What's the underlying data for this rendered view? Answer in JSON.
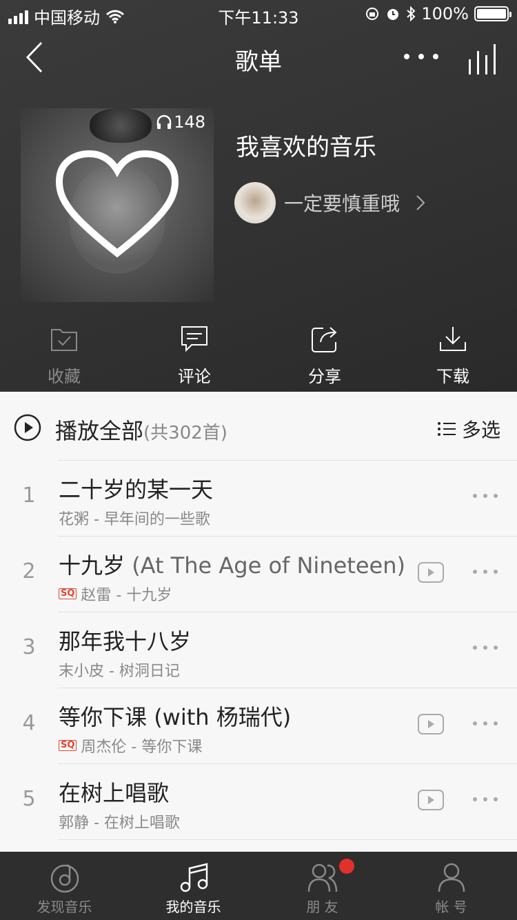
{
  "status_bar": {
    "carrier": "中国移动",
    "time": "下午11:33",
    "battery": "100%"
  },
  "nav": {
    "title": "歌单"
  },
  "playlist": {
    "play_count": "148",
    "title": "我喜欢的音乐",
    "creator": "一定要慎重哦"
  },
  "actions": [
    {
      "label": "收藏",
      "icon": "collect-icon",
      "enabled": false
    },
    {
      "label": "评论",
      "icon": "comment-icon",
      "enabled": true
    },
    {
      "label": "分享",
      "icon": "share-icon",
      "enabled": true
    },
    {
      "label": "下载",
      "icon": "download-icon",
      "enabled": true
    }
  ],
  "list_header": {
    "play_all": "播放全部",
    "count": "(共302首)",
    "multi_select": "多选"
  },
  "songs": [
    {
      "index": "1",
      "title": "二十岁的某一天",
      "subtitle": "",
      "sq": false,
      "meta": "花粥 - 早年间的一些歌",
      "mv": false
    },
    {
      "index": "2",
      "title": "十九岁",
      "subtitle": " (At The Age of Nineteen)",
      "sq": true,
      "meta": "赵雷 - 十九岁",
      "mv": true
    },
    {
      "index": "3",
      "title": "那年我十八岁",
      "subtitle": "",
      "sq": false,
      "meta": "末小皮 - 树洞日记",
      "mv": false
    },
    {
      "index": "4",
      "title": "等你下课",
      "subtitle": " (with 杨瑞代)",
      "sq": true,
      "meta": "周杰伦 - 等你下课",
      "mv": true
    },
    {
      "index": "5",
      "title": "在树上唱歌",
      "subtitle": "",
      "sq": false,
      "meta": "郭静 - 在树上唱歌",
      "mv": true
    }
  ],
  "sq_label": "SQ",
  "tabs": [
    {
      "label": "发现音乐",
      "icon": "discover-music-icon",
      "active": false
    },
    {
      "label": "我的音乐",
      "icon": "my-music-icon",
      "active": true
    },
    {
      "label": "朋 友",
      "icon": "friends-icon",
      "active": false
    },
    {
      "label": "帐 号",
      "icon": "account-icon",
      "active": false
    }
  ],
  "colors": {
    "accent_red": "#e0312a",
    "hero_bg": "#363636",
    "tabbar_bg": "#2e2e2e"
  }
}
